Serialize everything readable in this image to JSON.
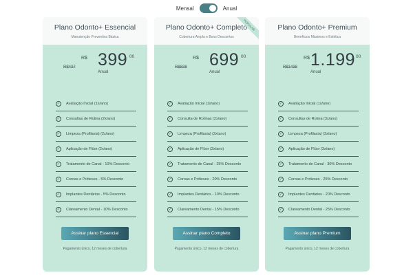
{
  "billing": {
    "monthly_label": "Mensal",
    "annual_label": "Anual",
    "selected": "Anual"
  },
  "plans": [
    {
      "name": "Plano Odonto+ Essencial",
      "subtitle": "Manutenção Preventiva Básica",
      "old_price": "R$437",
      "currency": "R$",
      "price": "399",
      "cents": "00",
      "period": "Anual",
      "features": [
        "Avaliação Inicial (1x/ano)",
        "Consultas de Rotina (2x/ano)",
        "Limpeza (Profilaxia) (2x/ano)",
        "Aplicação de Flúor (2x/ano)",
        "Tratamento de Canal - 10% Desconto",
        "Coroas e Próteses - 5% Desconto",
        "Implantes Dentários - 5% Desconto",
        "Clareamento Dental - 10% Desconto"
      ],
      "cta": "Assinar plano Essencial",
      "note": "Pagamento único, 12 meses de cobertura"
    },
    {
      "name": "Plano Odonto+ Completo",
      "subtitle": "Cobertura Ampla e Bons Descontos",
      "badge": "POPULAR",
      "old_price": "R$838",
      "currency": "R$",
      "price": "699",
      "cents": "00",
      "period": "Anual",
      "features": [
        "Avaliação Inicial (1x/ano)",
        "Consulta de Rotinas (2x/ano)",
        "Limpeza (Profilaxia) (2x/ano)",
        "Aplicação de Flúor (2x/ano)",
        "Tratamento de Canal - 25% Desconto",
        "Coroas e Próteses - 20% Desconto",
        "Implantes Dentários - 10% Desconto",
        "Clareamento Dental - 15% Desconto"
      ],
      "cta": "Assinar plano Completo",
      "note": "Pagamento único, 12 meses de cobertura"
    },
    {
      "name": "Plano Odonto+ Premium",
      "subtitle": "Benefícios Máximos e Estética",
      "old_price": "R$1438",
      "currency": "R$",
      "price": "1.199",
      "cents": "00",
      "period": "Anual",
      "features": [
        "Avaliação Inicial (1x/ano)",
        "Consultas de Rotina (3x/ano)",
        "Limpeza (Profilaxia) (3x/ano)",
        "Aplicação de Flúor (3x/ano)",
        "Tratamento de Canal - 30% Desconto",
        "Coroas e Próteses - 25% Desconto",
        "Implantes Dentários - 20% Desconto",
        "Clareamento Dental - 25% Desconto"
      ],
      "cta": "Assinar plano Premium",
      "note": "Pagamento único, 12 meses de cobertura"
    }
  ],
  "colors": {
    "card_bg": "#c5e8da",
    "button_start": "#5aa8b4",
    "button_end": "#2a5560",
    "toggle": "#4a7f86"
  }
}
